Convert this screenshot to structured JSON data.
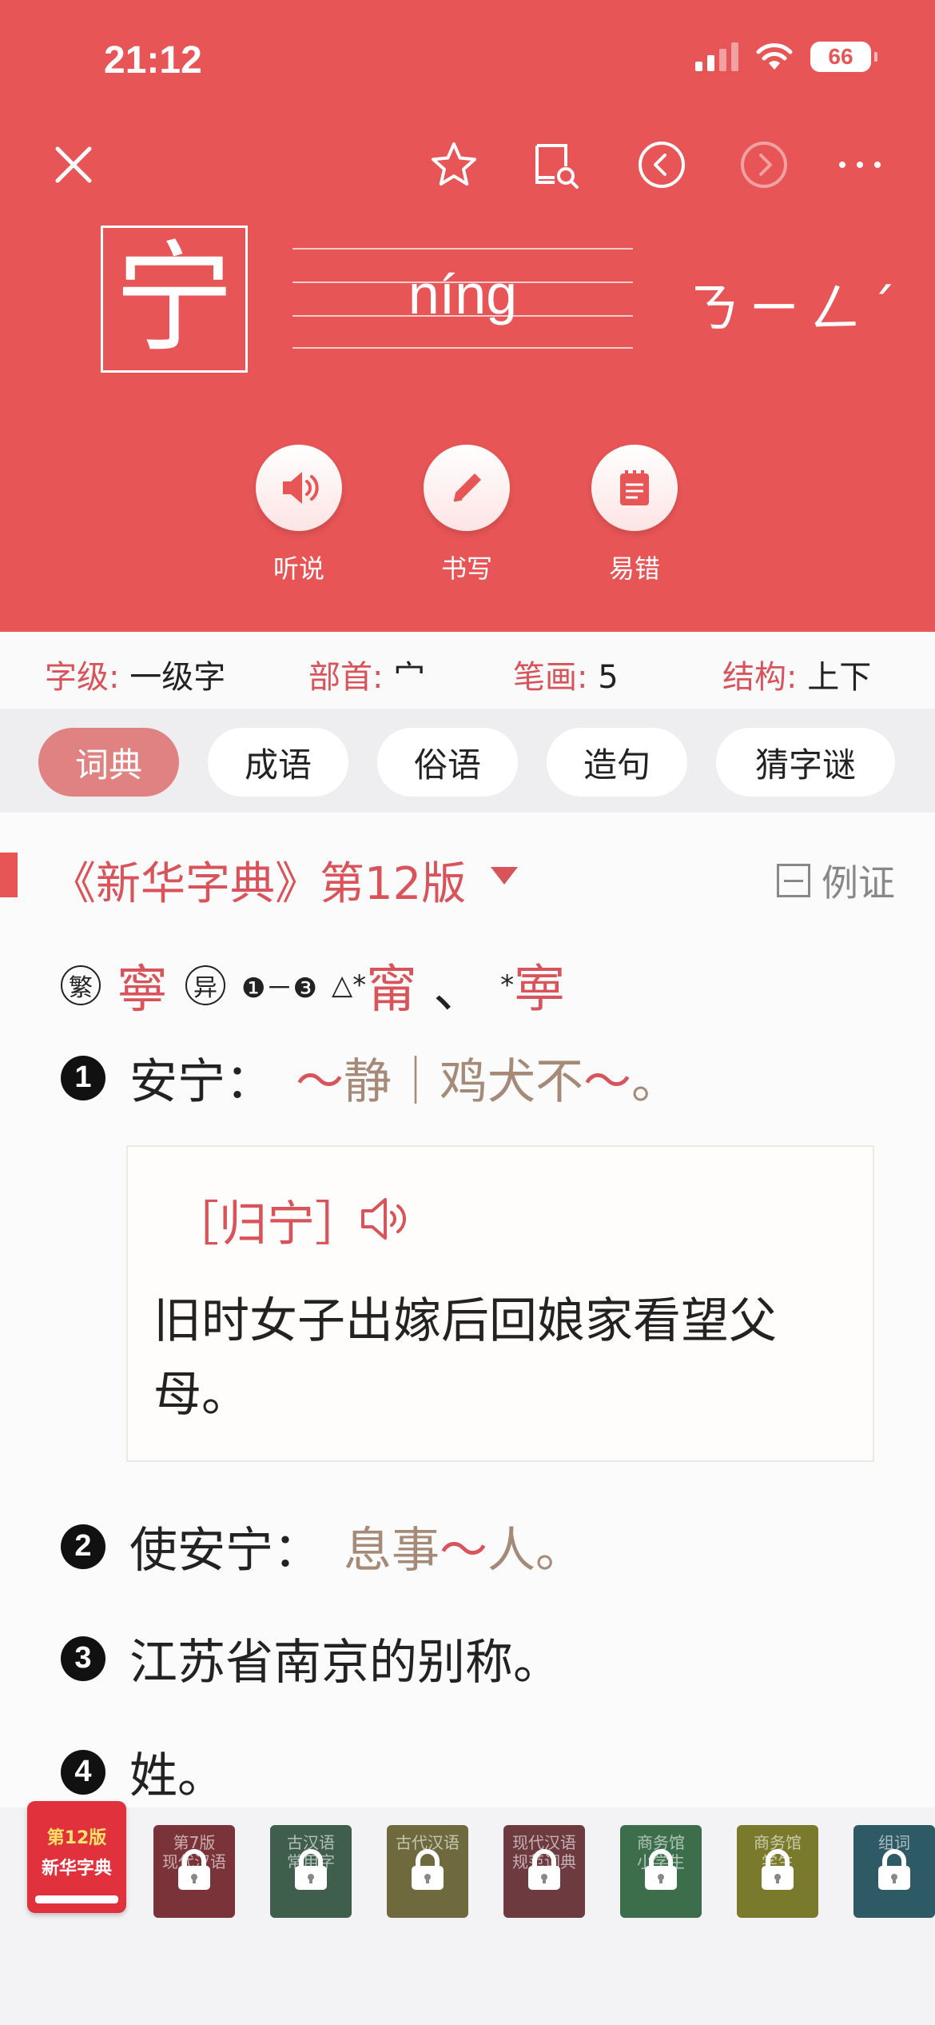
{
  "status_bar": {
    "time": "21:12",
    "battery": "66"
  },
  "character": {
    "glyph": "宁",
    "pinyin": "níng",
    "zhuyin": "ㄋㄧㄥˊ"
  },
  "actions": [
    {
      "label": "听说",
      "icon": "speaker-icon"
    },
    {
      "label": "书写",
      "icon": "pencil-icon"
    },
    {
      "label": "易错",
      "icon": "notepad-icon"
    }
  ],
  "info": {
    "level_key": "字级:",
    "level_val": "一级字",
    "radical_key": "部首:",
    "radical_val": "宀",
    "strokes_key": "笔画:",
    "strokes_val": "5",
    "structure_key": "结构:",
    "structure_val": "上下"
  },
  "tabs": [
    "词典",
    "成语",
    "俗语",
    "造句",
    "猜字谜"
  ],
  "edition": {
    "title": "《新华字典》第12版",
    "example_label": "例证"
  },
  "variants": {
    "fan_label": "繁",
    "fan_char": "寧",
    "yi_label": "异",
    "range": "❶－❸",
    "mark1": "△*",
    "char1": "甯",
    "sep": "、",
    "mark2": "*",
    "char2": "寕"
  },
  "senses": [
    {
      "num": "1",
      "text": "安宁：",
      "ex_a": "～",
      "ex_b": "静｜鸡犬不",
      "ex_c": "～",
      "ex_d": "。"
    },
    {
      "num": "2",
      "text": "使安宁：",
      "ex_a": "息事",
      "ex_b": "～",
      "ex_c": "人。"
    },
    {
      "num": "3",
      "text": "江苏省南京的别称。"
    },
    {
      "num": "4",
      "text": "姓。"
    }
  ],
  "card": {
    "term": "［归宁］",
    "definition": "旧时女子出嫁后回娘家看望父母。"
  },
  "books": [
    {
      "l1": "第12版",
      "l2": "新华字典",
      "color": "#e0313c"
    },
    {
      "title": "第7版\n现代汉语",
      "color": "#7a3338"
    },
    {
      "title": "古汉语\n常用字",
      "color": "#3f5e4c"
    },
    {
      "title": "古代汉语",
      "color": "#6e6a3e"
    },
    {
      "title": "现代汉语\n规范词典",
      "color": "#6d3a40"
    },
    {
      "title": "商务馆\n小学生",
      "color": "#3c6e4c"
    },
    {
      "title": "商务馆\n学生",
      "color": "#7a7a2c"
    },
    {
      "title": "组词",
      "color": "#2e5a66"
    }
  ]
}
